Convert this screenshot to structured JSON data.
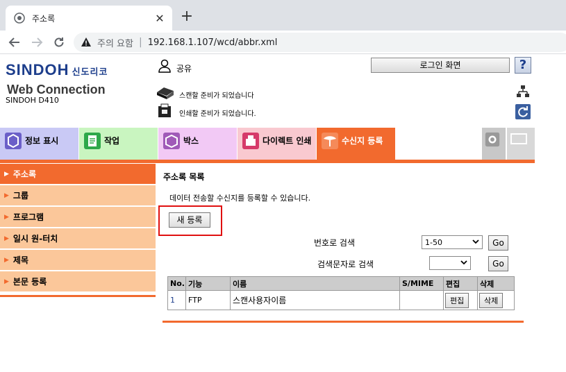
{
  "browser": {
    "tab_title": "주소록",
    "close_glyph": "✕",
    "new_tab_glyph": "+",
    "security_text": "주의 요함",
    "url": "192.168.1.107/wcd/abbr.xml"
  },
  "header": {
    "brand": "SINDOH",
    "brand_kr": "신도리코",
    "product": "Web Connection",
    "model": "SINDOH D410",
    "user_label": "공유",
    "login_button": "로그인 화면",
    "help_label": "?",
    "scan_status": "스캔할 준비가 되었습니다",
    "print_status": "인쇄할 준비가 되었습니다."
  },
  "tabs": [
    {
      "label": "정보 표시",
      "color": "#c9c9f5"
    },
    {
      "label": "작업",
      "color": "#c9f5c0"
    },
    {
      "label": "박스",
      "color": "#f2c9f5"
    },
    {
      "label": "다이렉트 인쇄",
      "color": "#f9c9d0"
    },
    {
      "label": "수신지 등록",
      "color": "#f26a2e"
    }
  ],
  "sidebar": {
    "items": [
      {
        "label": "주소록"
      },
      {
        "label": "그룹"
      },
      {
        "label": "프로그램"
      },
      {
        "label": "일시 원-터치"
      },
      {
        "label": "제목"
      },
      {
        "label": "본문 등록"
      }
    ]
  },
  "main": {
    "title": "주소록 목록",
    "description": "데이터 전송할 수신지를 등록할 수 있습니다.",
    "new_button": "새 등록",
    "search_by_number": "번호로 검색",
    "number_select": "1-50",
    "go1": "Go",
    "search_by_char": "검색문자로 검색",
    "char_select": "",
    "go2": "Go",
    "table": {
      "headers": [
        "No.",
        "기능",
        "이름",
        "S/MIME",
        "편집",
        "삭제"
      ],
      "rows": [
        {
          "no": "1",
          "func": "FTP",
          "name": "스캔사용자이름",
          "smime": "",
          "edit": "편집",
          "delete": "삭제"
        }
      ]
    }
  },
  "colors": {
    "accent": "#f26a2e",
    "sidebar_bg": "#fbc79a",
    "brand": "#1d3e8c",
    "highlight": "#e01010"
  }
}
